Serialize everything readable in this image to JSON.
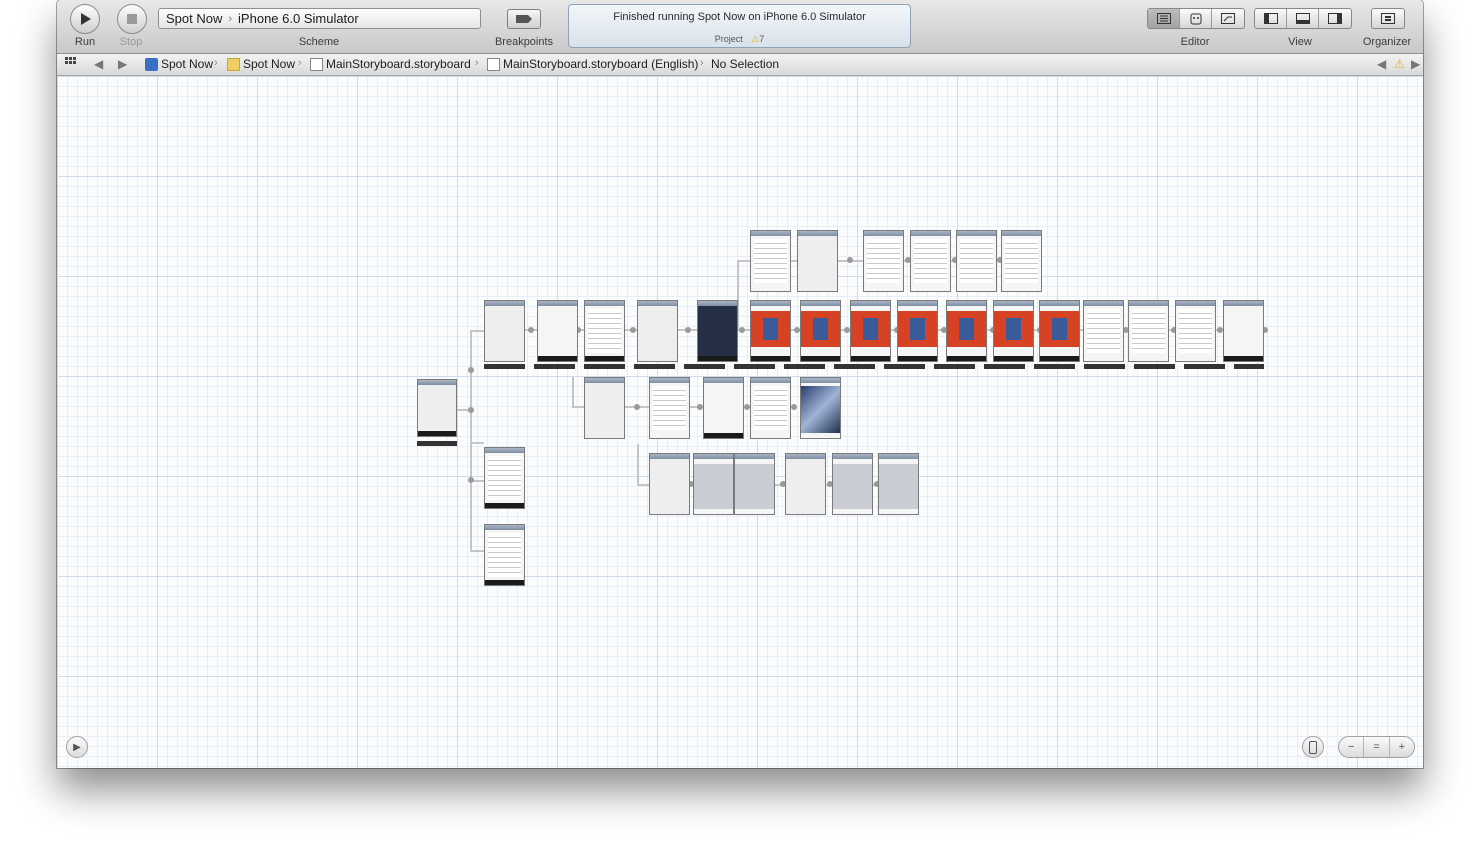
{
  "toolbar": {
    "run_label": "Run",
    "stop_label": "Stop",
    "scheme_label": "Scheme",
    "scheme_target": "Spot Now",
    "scheme_destination": "iPhone 6.0 Simulator",
    "breakpoints_label": "Breakpoints",
    "activity_message": "Finished running Spot Now on iPhone 6.0 Simulator",
    "activity_project_label": "Project",
    "warning_count": "7",
    "editor_label": "Editor",
    "view_label": "View",
    "organizer_label": "Organizer"
  },
  "jumpbar": {
    "items": [
      "Spot Now",
      "Spot Now",
      "MainStoryboard.storyboard",
      "MainStoryboard.storyboard (English)",
      "No Selection"
    ]
  },
  "icons": {
    "run": "play-icon",
    "stop": "stop-icon",
    "breakpoints": "breakpoint-icon",
    "warning": "warning-icon",
    "organizer": "organizer-icon",
    "zoom_out": "zoom-out-icon",
    "zoom_fit": "zoom-fit-icon",
    "zoom_in": "zoom-in-icon",
    "device": "iphone-icon",
    "document_outline": "document-outline-icon"
  },
  "colors": {
    "accent_red": "#d64224",
    "grid_line": "#cfdaea",
    "toolbar_top": "#e8e8e8",
    "warning": "#e8b400"
  }
}
